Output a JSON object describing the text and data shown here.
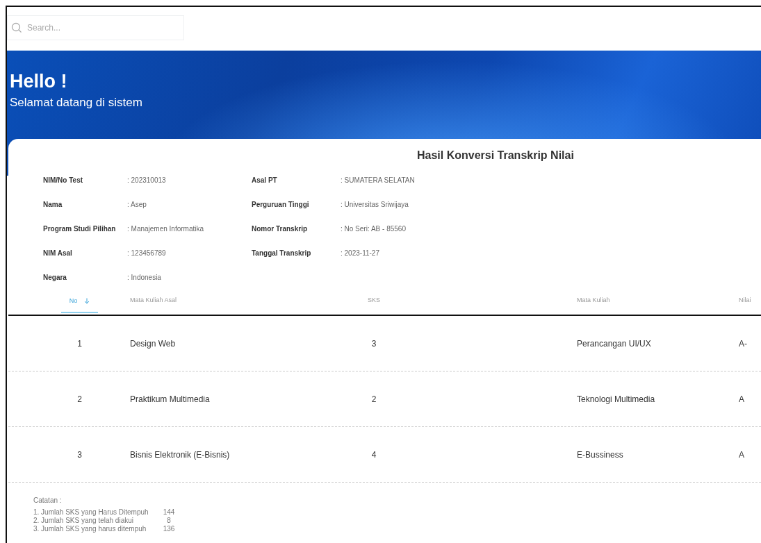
{
  "search": {
    "placeholder": "Search..."
  },
  "banner": {
    "title": "Hello !",
    "subtitle": "Selamat datang di sistem"
  },
  "transcript": {
    "title": "Hasil Konversi Transkrip Nilai",
    "info_left": [
      {
        "label": "NIM/No Test",
        "value": ": 202310013"
      },
      {
        "label": "Nama",
        "value": ": Asep"
      },
      {
        "label": "Program Studi Pilihan",
        "value": ": Manajemen Informatika"
      },
      {
        "label": "NIM Asal",
        "value": ": 123456789"
      },
      {
        "label": "Negara",
        "value": ": Indonesia"
      }
    ],
    "info_right": [
      {
        "label": "Asal PT",
        "value": ": SUMATERA SELATAN"
      },
      {
        "label": "Perguruan Tinggi",
        "value": ": Universitas Sriwijaya"
      },
      {
        "label": "Nomor Transkrip",
        "value": ": No Seri: AB - 85560"
      },
      {
        "label": "Tanggal Transkrip",
        "value": ": 2023-11-27"
      }
    ]
  },
  "table": {
    "columns": [
      {
        "label": "No",
        "sorted": true
      },
      {
        "label": "Mata Kuliah Asal",
        "sorted": false
      },
      {
        "label": "SKS",
        "sorted": false
      },
      {
        "label": "Mata Kuliah",
        "sorted": false
      },
      {
        "label": "Nilai",
        "sorted": false
      }
    ],
    "rows": [
      {
        "no": "1",
        "course_origin": "Design Web",
        "sks": "3",
        "course": "Perancangan UI/UX",
        "grade": "A-"
      },
      {
        "no": "2",
        "course_origin": "Praktikum Multimedia",
        "sks": "2",
        "course": "Teknologi Multimedia",
        "grade": "A"
      },
      {
        "no": "3",
        "course_origin": "Bisnis Elektronik (E-Bisnis)",
        "sks": "4",
        "course": "E-Bussiness",
        "grade": "A"
      }
    ]
  },
  "notes": {
    "title": "Catatan :",
    "items": [
      {
        "text": "1. Jumlah SKS yang Harus Ditempuh",
        "value": "144"
      },
      {
        "text": "2. Jumlah SKS yang telah diakui",
        "value": "8"
      },
      {
        "text": "3. Jumlah SKS yang harus ditempuh",
        "value": "136"
      }
    ]
  }
}
